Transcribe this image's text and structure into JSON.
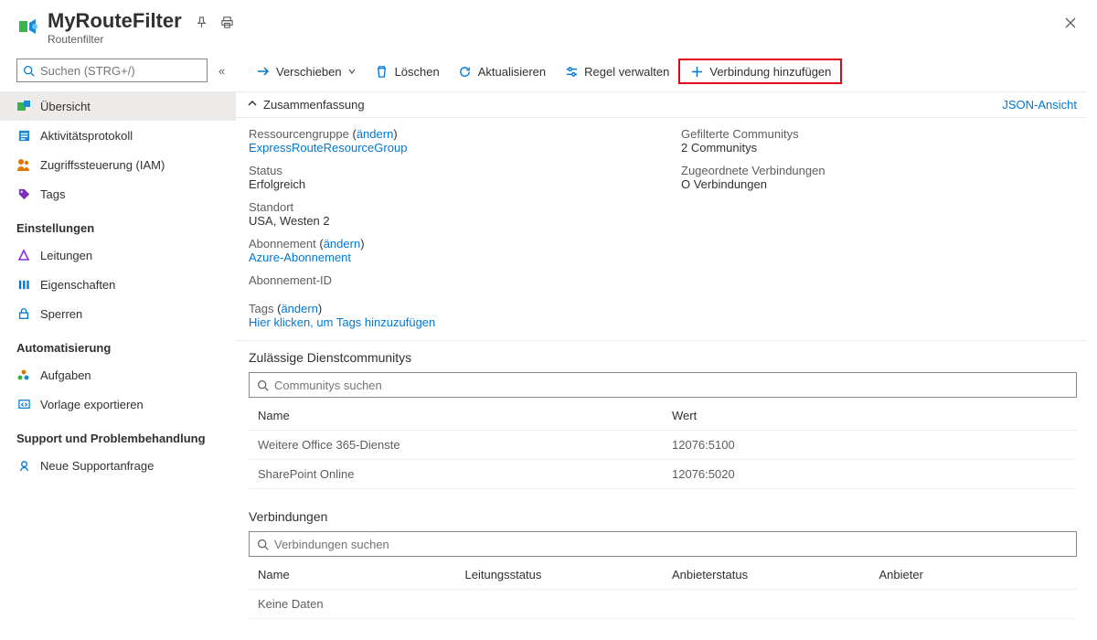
{
  "header": {
    "title": "MyRouteFilter",
    "subtitle": "Routenfilter"
  },
  "sidebar": {
    "search_placeholder": "Suchen (STRG+/)",
    "groups": [
      {
        "heading": null,
        "items": [
          {
            "key": "overview",
            "label": "Übersicht",
            "active": true
          },
          {
            "key": "activity-log",
            "label": "Aktivitätsprotokoll"
          },
          {
            "key": "iam",
            "label": "Zugriffssteuerung (IAM)"
          },
          {
            "key": "tags",
            "label": "Tags"
          }
        ]
      },
      {
        "heading": "Einstellungen",
        "items": [
          {
            "key": "circuits",
            "label": "Leitungen"
          },
          {
            "key": "properties",
            "label": "Eigenschaften"
          },
          {
            "key": "locks",
            "label": "Sperren"
          }
        ]
      },
      {
        "heading": "Automatisierung",
        "items": [
          {
            "key": "tasks",
            "label": "Aufgaben"
          },
          {
            "key": "export-template",
            "label": "Vorlage exportieren"
          }
        ]
      },
      {
        "heading": "Support und Problembehandlung",
        "items": [
          {
            "key": "new-support",
            "label": "Neue Supportanfrage"
          }
        ]
      }
    ]
  },
  "toolbar": {
    "move": "Verschieben",
    "delete": "Löschen",
    "refresh": "Aktualisieren",
    "manage_rule": "Regel verwalten",
    "add_connection": "Verbindung hinzufügen"
  },
  "essentials": {
    "header": "Zusammenfassung",
    "json_view": "JSON-Ansicht",
    "resource_group_label": "Ressourcengruppe",
    "change": "ändern",
    "resource_group_value": "ExpressRouteResourceGroup",
    "status_label": "Status",
    "status_value": "Erfolgreich",
    "location_label": "Standort",
    "location_value": "USA, Westen 2",
    "subscription_label": "Abonnement",
    "subscription_value": "Azure-Abonnement",
    "subscription_id_label": "Abonnement-ID",
    "filtered_communities_label": "Gefilterte Communitys",
    "filtered_communities_value": "2 Communitys",
    "associated_connections_label": "Zugeordnete Verbindungen",
    "associated_connections_value": "O Verbindungen",
    "tags_label": "Tags",
    "tags_add": "Hier klicken, um Tags hinzuzufügen"
  },
  "communities": {
    "title": "Zulässige Dienstcommunitys",
    "search_placeholder": "Communitys suchen",
    "col_name": "Name",
    "col_value": "Wert",
    "rows": [
      {
        "name": "Weitere Office 365-Dienste",
        "value": "12076:5100"
      },
      {
        "name": "SharePoint Online",
        "value": "12076:5020"
      }
    ]
  },
  "connections": {
    "title": "Verbindungen",
    "search_placeholder": "Verbindungen suchen",
    "col_name": "Name",
    "col_circuit_status": "Leitungsstatus",
    "col_provider_status": "Anbieterstatus",
    "col_provider": "Anbieter",
    "empty": "Keine Daten"
  }
}
